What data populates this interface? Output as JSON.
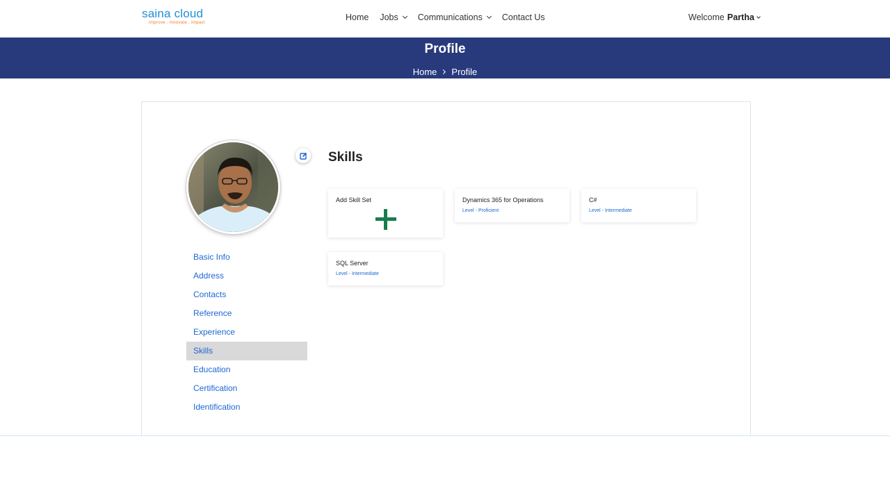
{
  "header": {
    "logo_main": "saina cloud",
    "logo_tagline": "Improve . Innovate . Impact",
    "nav": [
      {
        "label": "Home",
        "has_dropdown": false
      },
      {
        "label": "Jobs",
        "has_dropdown": true
      },
      {
        "label": "Communications",
        "has_dropdown": true
      },
      {
        "label": "Contact Us",
        "has_dropdown": false
      }
    ],
    "welcome_prefix": "Welcome",
    "user_name": "Partha"
  },
  "banner": {
    "title": "Profile",
    "breadcrumb": [
      "Home",
      "Profile"
    ]
  },
  "sidebar": {
    "active_index": 5,
    "items": [
      {
        "label": "Basic Info"
      },
      {
        "label": "Address"
      },
      {
        "label": "Contacts"
      },
      {
        "label": "Reference"
      },
      {
        "label": "Experience"
      },
      {
        "label": "Skills"
      },
      {
        "label": "Education"
      },
      {
        "label": "Certification"
      },
      {
        "label": "Identification"
      }
    ]
  },
  "main": {
    "section_title": "Skills",
    "add_tile_label": "Add Skill Set",
    "skills": [
      {
        "name": "Dynamics 365 for Operations",
        "level": "Level - Proficient"
      },
      {
        "name": "C#",
        "level": "Level - Intermediate"
      },
      {
        "name": "SQL Server",
        "level": "Level - Intermediate"
      }
    ]
  },
  "colors": {
    "banner_bg": "#283a7c",
    "link_blue": "#1f67d2",
    "logo_blue": "#1f8fd6",
    "logo_orange": "#f07b22",
    "add_plus_green": "#1a7c4f",
    "active_item_bg": "#d9d9d9"
  }
}
